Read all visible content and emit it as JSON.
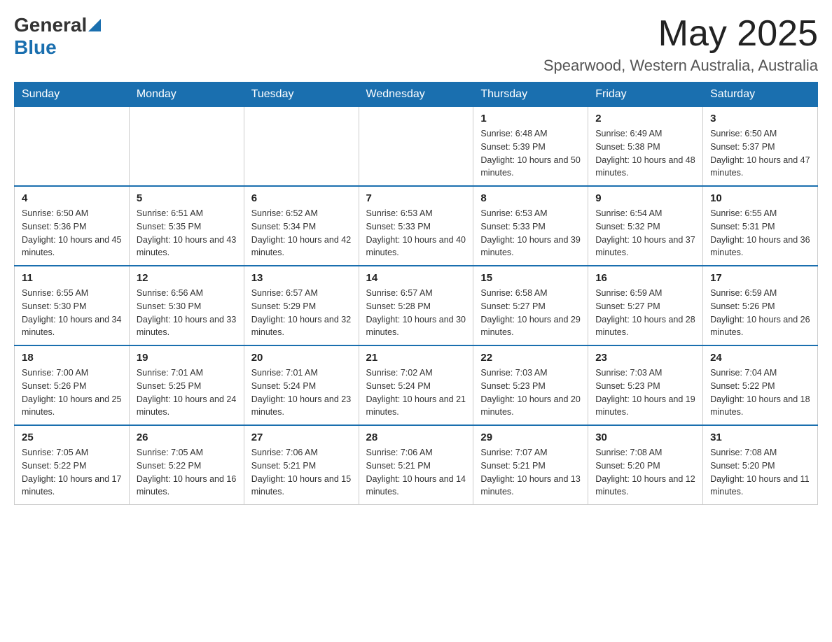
{
  "header": {
    "logo_general": "General",
    "logo_blue": "Blue",
    "month_year": "May 2025",
    "location": "Spearwood, Western Australia, Australia"
  },
  "days_of_week": [
    "Sunday",
    "Monday",
    "Tuesday",
    "Wednesday",
    "Thursday",
    "Friday",
    "Saturday"
  ],
  "weeks": [
    {
      "days": [
        {
          "number": "",
          "info": ""
        },
        {
          "number": "",
          "info": ""
        },
        {
          "number": "",
          "info": ""
        },
        {
          "number": "",
          "info": ""
        },
        {
          "number": "1",
          "info": "Sunrise: 6:48 AM\nSunset: 5:39 PM\nDaylight: 10 hours and 50 minutes."
        },
        {
          "number": "2",
          "info": "Sunrise: 6:49 AM\nSunset: 5:38 PM\nDaylight: 10 hours and 48 minutes."
        },
        {
          "number": "3",
          "info": "Sunrise: 6:50 AM\nSunset: 5:37 PM\nDaylight: 10 hours and 47 minutes."
        }
      ]
    },
    {
      "days": [
        {
          "number": "4",
          "info": "Sunrise: 6:50 AM\nSunset: 5:36 PM\nDaylight: 10 hours and 45 minutes."
        },
        {
          "number": "5",
          "info": "Sunrise: 6:51 AM\nSunset: 5:35 PM\nDaylight: 10 hours and 43 minutes."
        },
        {
          "number": "6",
          "info": "Sunrise: 6:52 AM\nSunset: 5:34 PM\nDaylight: 10 hours and 42 minutes."
        },
        {
          "number": "7",
          "info": "Sunrise: 6:53 AM\nSunset: 5:33 PM\nDaylight: 10 hours and 40 minutes."
        },
        {
          "number": "8",
          "info": "Sunrise: 6:53 AM\nSunset: 5:33 PM\nDaylight: 10 hours and 39 minutes."
        },
        {
          "number": "9",
          "info": "Sunrise: 6:54 AM\nSunset: 5:32 PM\nDaylight: 10 hours and 37 minutes."
        },
        {
          "number": "10",
          "info": "Sunrise: 6:55 AM\nSunset: 5:31 PM\nDaylight: 10 hours and 36 minutes."
        }
      ]
    },
    {
      "days": [
        {
          "number": "11",
          "info": "Sunrise: 6:55 AM\nSunset: 5:30 PM\nDaylight: 10 hours and 34 minutes."
        },
        {
          "number": "12",
          "info": "Sunrise: 6:56 AM\nSunset: 5:30 PM\nDaylight: 10 hours and 33 minutes."
        },
        {
          "number": "13",
          "info": "Sunrise: 6:57 AM\nSunset: 5:29 PM\nDaylight: 10 hours and 32 minutes."
        },
        {
          "number": "14",
          "info": "Sunrise: 6:57 AM\nSunset: 5:28 PM\nDaylight: 10 hours and 30 minutes."
        },
        {
          "number": "15",
          "info": "Sunrise: 6:58 AM\nSunset: 5:27 PM\nDaylight: 10 hours and 29 minutes."
        },
        {
          "number": "16",
          "info": "Sunrise: 6:59 AM\nSunset: 5:27 PM\nDaylight: 10 hours and 28 minutes."
        },
        {
          "number": "17",
          "info": "Sunrise: 6:59 AM\nSunset: 5:26 PM\nDaylight: 10 hours and 26 minutes."
        }
      ]
    },
    {
      "days": [
        {
          "number": "18",
          "info": "Sunrise: 7:00 AM\nSunset: 5:26 PM\nDaylight: 10 hours and 25 minutes."
        },
        {
          "number": "19",
          "info": "Sunrise: 7:01 AM\nSunset: 5:25 PM\nDaylight: 10 hours and 24 minutes."
        },
        {
          "number": "20",
          "info": "Sunrise: 7:01 AM\nSunset: 5:24 PM\nDaylight: 10 hours and 23 minutes."
        },
        {
          "number": "21",
          "info": "Sunrise: 7:02 AM\nSunset: 5:24 PM\nDaylight: 10 hours and 21 minutes."
        },
        {
          "number": "22",
          "info": "Sunrise: 7:03 AM\nSunset: 5:23 PM\nDaylight: 10 hours and 20 minutes."
        },
        {
          "number": "23",
          "info": "Sunrise: 7:03 AM\nSunset: 5:23 PM\nDaylight: 10 hours and 19 minutes."
        },
        {
          "number": "24",
          "info": "Sunrise: 7:04 AM\nSunset: 5:22 PM\nDaylight: 10 hours and 18 minutes."
        }
      ]
    },
    {
      "days": [
        {
          "number": "25",
          "info": "Sunrise: 7:05 AM\nSunset: 5:22 PM\nDaylight: 10 hours and 17 minutes."
        },
        {
          "number": "26",
          "info": "Sunrise: 7:05 AM\nSunset: 5:22 PM\nDaylight: 10 hours and 16 minutes."
        },
        {
          "number": "27",
          "info": "Sunrise: 7:06 AM\nSunset: 5:21 PM\nDaylight: 10 hours and 15 minutes."
        },
        {
          "number": "28",
          "info": "Sunrise: 7:06 AM\nSunset: 5:21 PM\nDaylight: 10 hours and 14 minutes."
        },
        {
          "number": "29",
          "info": "Sunrise: 7:07 AM\nSunset: 5:21 PM\nDaylight: 10 hours and 13 minutes."
        },
        {
          "number": "30",
          "info": "Sunrise: 7:08 AM\nSunset: 5:20 PM\nDaylight: 10 hours and 12 minutes."
        },
        {
          "number": "31",
          "info": "Sunrise: 7:08 AM\nSunset: 5:20 PM\nDaylight: 10 hours and 11 minutes."
        }
      ]
    }
  ]
}
